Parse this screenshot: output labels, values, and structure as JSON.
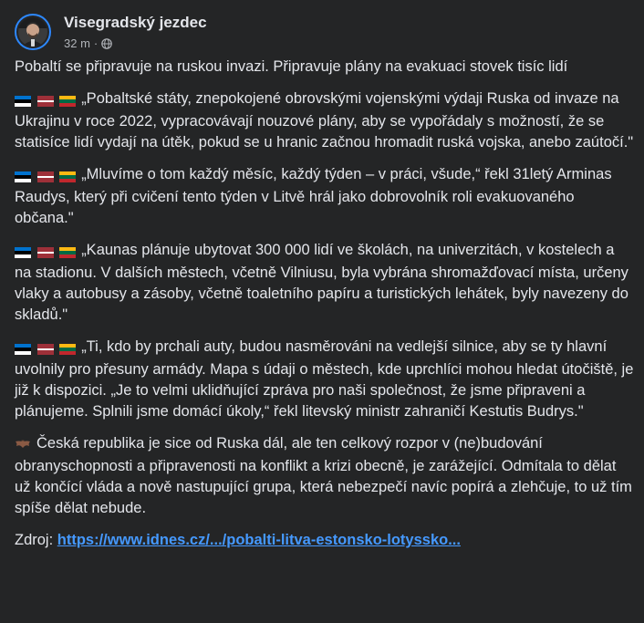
{
  "post": {
    "author": "Visegradský jezdec",
    "time": "32 m",
    "separator": "·",
    "privacy_icon": "globe-icon",
    "colors": {
      "background": "#242526",
      "text": "#e4e6eb",
      "muted": "#b0b3b8",
      "link": "#4599ff",
      "avatar_ring": "#2d88ff"
    }
  },
  "content": {
    "headline": "Pobaltí se připravuje na ruskou invazi. Připravuje plány na evakuaci stovek tisíc lidí",
    "paragraphs": [
      {
        "flags": [
          "estonia-flag",
          "latvia-flag",
          "lithuania-flag"
        ],
        "text": "„Pobaltské státy, znepokojené obrovskými vojenskými výdaji Ruska od invaze na Ukrajinu v roce 2022, vypracovávají nouzové plány, aby se vypořádaly s možností, že se statisíce lidí vydají na útěk, pokud se u hranic začnou hromadit ruská vojska, anebo zaútočí.\""
      },
      {
        "flags": [
          "estonia-flag",
          "latvia-flag",
          "lithuania-flag"
        ],
        "text": "„Mluvíme o tom každý měsíc, každý týden – v práci, všude,“ řekl 31letý Arminas Raudys, který při cvičení tento týden v Litvě hrál jako dobrovolník roli evakuovaného občana.\""
      },
      {
        "flags": [
          "estonia-flag",
          "latvia-flag",
          "lithuania-flag"
        ],
        "text": "„Kaunas plánuje ubytovat 300 000 lidí ve školách, na univerzitách, v kostelech a na stadionu. V dalších městech, včetně Vilniusu, byla vybrána shromažďovací místa, určeny vlaky a autobusy a zásoby, včetně toaletního papíru a turistických lehátek, byly navezeny do skladů.\""
      },
      {
        "flags": [
          "estonia-flag",
          "latvia-flag",
          "lithuania-flag"
        ],
        "text": "„Ti, kdo by prchali auty, budou nasměrováni na vedlejší silnice, aby se ty hlavní uvolnily pro přesuny armády. Mapa s údaji o městech, kde uprchlíci mohou hledat útočiště, je již k dispozici. „Je to velmi uklidňující zpráva pro naši společnost, že jsme připraveni a plánujeme. Splnili jsme domácí úkoly,“ řekl litevský ministr zahraničí Kestutis Budrys.\""
      }
    ],
    "closing": {
      "icon": "bat-icon",
      "text": "Česká republika je sice od Ruska dál, ale ten celkový rozpor v (ne)budování obranyschopnosti a připravenosti na konflikt a krizi obecně, je zarážející. Odmítala to dělat už končící vláda a nově nastupující grupa, která nebezpečí navíc popírá a zlehčuje, to už tím spíše dělat nebude."
    },
    "source": {
      "label": "Zdroj: ",
      "link_text": "https://www.idnes.cz/.../pobalti-litva-estonsko-lotyssko..."
    }
  }
}
